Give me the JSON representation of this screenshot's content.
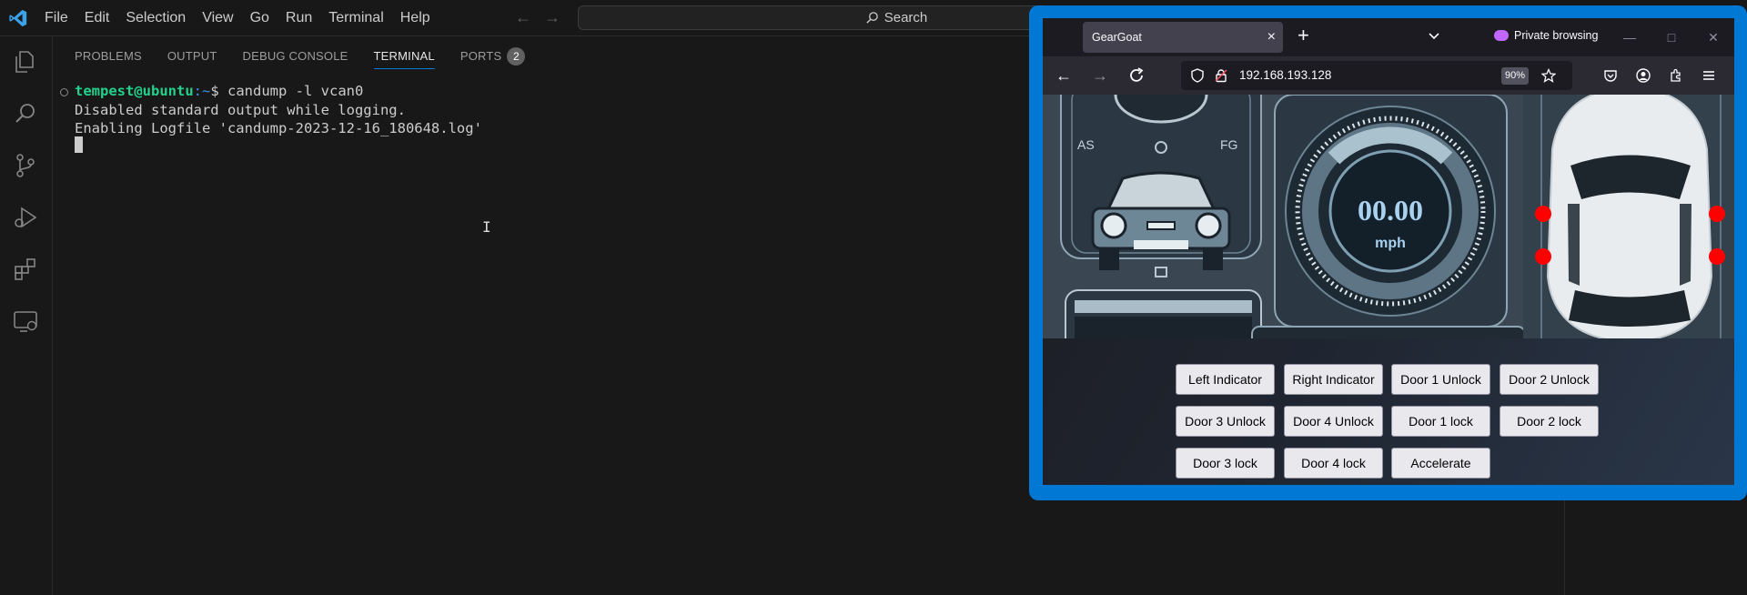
{
  "vscode": {
    "menu": [
      "File",
      "Edit",
      "Selection",
      "View",
      "Go",
      "Run",
      "Terminal",
      "Help"
    ],
    "search_label": "Search",
    "activity_icons": [
      "explorer-icon",
      "search-icon",
      "source-control-icon",
      "run-debug-icon",
      "extensions-icon",
      "remote-explorer-icon"
    ],
    "panel_tabs": [
      "PROBLEMS",
      "OUTPUT",
      "DEBUG CONSOLE",
      "TERMINAL",
      "PORTS"
    ],
    "active_panel_tab": "TERMINAL",
    "ports_count": "2",
    "terminal": {
      "prompt_user": "tempest@ubuntu",
      "prompt_path": ":~",
      "prompt_symbol": "$ ",
      "command": "candump -l vcan0",
      "output": [
        "Disabled standard output while logging.",
        "Enabling Logfile 'candump-2023-12-16_180648.log'"
      ]
    },
    "colors": {
      "accent": "#0078d4",
      "prompt_user": "#23d18b",
      "prompt_path": "#3b8eea"
    }
  },
  "browser": {
    "tab_title": "GearGoat",
    "private_label": "Private browsing",
    "url": "192.168.193.128",
    "zoom": "90%",
    "dashboard": {
      "speed": "00.00",
      "unit": "mph",
      "left_label": "AS",
      "right_label": "FG"
    },
    "buttons": [
      [
        "Left Indicator",
        "Right Indicator",
        "Door 1 Unlock",
        "Door 2 Unlock"
      ],
      [
        "Door 3 Unlock",
        "Door 4 Unlock",
        "Door 1 lock",
        "Door 2 lock"
      ],
      [
        "Door 3 lock",
        "Door 4 lock",
        "Accelerate"
      ]
    ],
    "colors": {
      "frame": "#0078d4",
      "door_indicator": "#ff0000"
    }
  }
}
